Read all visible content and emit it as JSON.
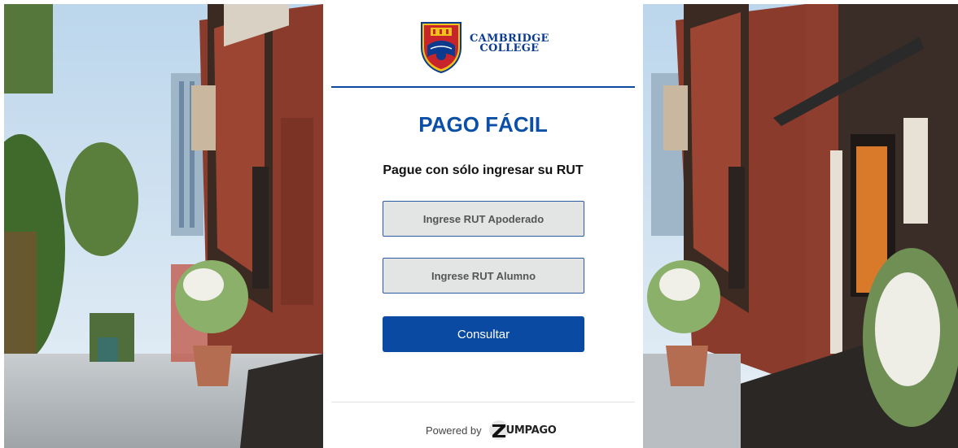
{
  "brand": {
    "logo_line1": "CAMBRIDGE",
    "logo_line2": "COLLEGE"
  },
  "page": {
    "title": "PAGO FÁCIL",
    "subtitle": "Pague con sólo ingresar su RUT"
  },
  "form": {
    "apoderado_placeholder": "Ingrese RUT Apoderado",
    "apoderado_value": "",
    "alumno_placeholder": "Ingrese RUT Alumno",
    "alumno_value": "",
    "submit_label": "Consultar"
  },
  "footer": {
    "powered_by": "Powered by",
    "provider_name": "UMPAGO"
  },
  "colors": {
    "primary": "#0a4aa3",
    "title": "#0c4fa6",
    "field_bg": "#e3e4e4",
    "field_border": "#2b5aa0"
  },
  "images": {
    "left_photo": "school-building-entrance-photo",
    "right_photo": "school-building-entrance-photo"
  }
}
